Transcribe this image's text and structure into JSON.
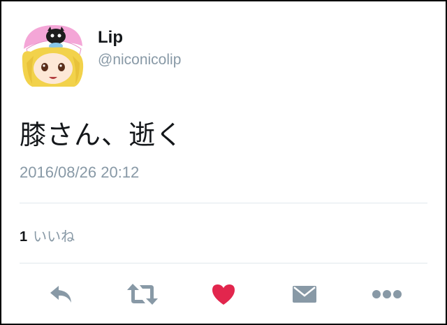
{
  "user": {
    "name": "Lip",
    "handle": "@niconicolip"
  },
  "tweet": {
    "text": "膝さん、逝く",
    "timestamp": "2016/08/26 20:12"
  },
  "likes": {
    "count": "1",
    "label": "いいね"
  },
  "actions": [
    {
      "icon": "reply-icon"
    },
    {
      "icon": "retweet-icon"
    },
    {
      "icon": "like-heart-icon",
      "color": "#e2264d"
    },
    {
      "icon": "direct-message-icon"
    },
    {
      "icon": "more-options-icon"
    }
  ],
  "colors": {
    "icon_gray": "#8899a6",
    "like_active": "#e2264d",
    "text_primary": "#14171a"
  }
}
